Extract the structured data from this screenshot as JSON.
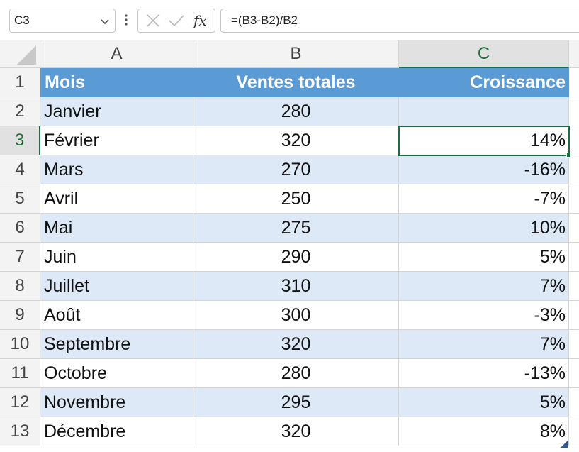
{
  "name_box": {
    "value": "C3"
  },
  "formula_bar": {
    "fx_label": "fx",
    "formula": "=(B3-B2)/B2"
  },
  "columns": [
    "A",
    "B",
    "C"
  ],
  "active_cell": {
    "col": "C",
    "row": "3"
  },
  "sheet": {
    "header": {
      "label": "1",
      "cells": [
        "Mois",
        "Ventes totales",
        "Croissance"
      ]
    },
    "rows": [
      {
        "label": "2",
        "month": "Janvier",
        "sales": "280",
        "growth": ""
      },
      {
        "label": "3",
        "month": "Février",
        "sales": "320",
        "growth": "14%"
      },
      {
        "label": "4",
        "month": "Mars",
        "sales": "270",
        "growth": "-16%"
      },
      {
        "label": "5",
        "month": "Avril",
        "sales": "250",
        "growth": "-7%"
      },
      {
        "label": "6",
        "month": "Mai",
        "sales": "275",
        "growth": "10%"
      },
      {
        "label": "7",
        "month": "Juin",
        "sales": "290",
        "growth": "5%"
      },
      {
        "label": "8",
        "month": "Juillet",
        "sales": "310",
        "growth": "7%"
      },
      {
        "label": "9",
        "month": "Août",
        "sales": "300",
        "growth": "-3%"
      },
      {
        "label": "10",
        "month": "Septembre",
        "sales": "320",
        "growth": "7%"
      },
      {
        "label": "11",
        "month": "Octobre",
        "sales": "280",
        "growth": "-13%"
      },
      {
        "label": "12",
        "month": "Novembre",
        "sales": "295",
        "growth": "5%"
      },
      {
        "label": "13",
        "month": "Décembre",
        "sales": "320",
        "growth": "8%"
      }
    ]
  },
  "colors": {
    "header_fill": "#5b9bd5",
    "band_fill": "#dde9f6",
    "selection": "#1e6e3d"
  },
  "icons": {
    "name_box_dropdown": "chevron-down-icon",
    "more": "vertical-dots-icon",
    "cancel": "cancel-x-icon",
    "enter": "checkmark-icon"
  }
}
